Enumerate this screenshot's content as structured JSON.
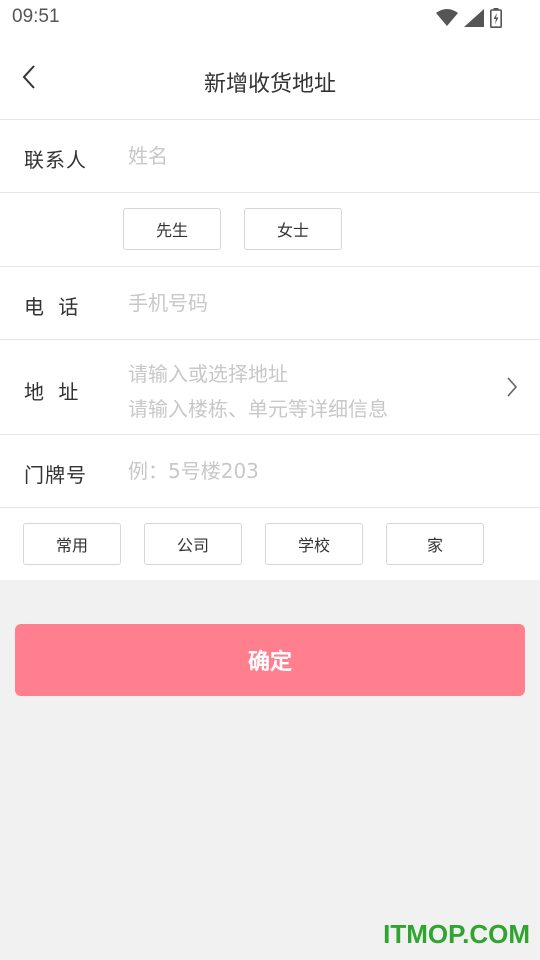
{
  "status": {
    "time": "09:51",
    "icons": [
      "wifi-icon",
      "signal-icon",
      "battery-icon"
    ]
  },
  "nav": {
    "back_icon": "chevron-left-icon",
    "title": "新增收货地址"
  },
  "form": {
    "contact": {
      "label": "联系人",
      "placeholder": "姓名",
      "value": ""
    },
    "gender": {
      "options": [
        "先生",
        "女士"
      ]
    },
    "phone": {
      "label": "电 话",
      "placeholder": "手机号码",
      "value": ""
    },
    "address": {
      "label": "地 址",
      "line1": "请输入或选择地址",
      "line2": "请输入楼栋、单元等详细信息",
      "icon": "chevron-right-icon"
    },
    "door": {
      "label": "门牌号",
      "placeholder": "例：5号楼203",
      "value": ""
    },
    "tags": [
      "常用",
      "公司",
      "学校",
      "家"
    ]
  },
  "confirm_label": "确定",
  "watermark": "ITMOP.COM",
  "colors": {
    "accent": "#ff7f8e",
    "watermark": "#2fa52f",
    "placeholder": "#c8c8c8",
    "page_bg": "#f1f1f1"
  }
}
